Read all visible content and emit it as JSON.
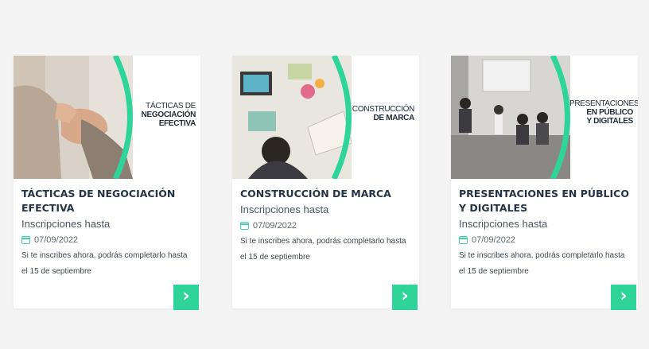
{
  "colors": {
    "accent": "#2fd49a",
    "title": "#233447",
    "background": "#f4f4f5"
  },
  "cards": [
    {
      "thumb_line1": "TÁCTICAS DE",
      "thumb_line2": "NEGOCIACIÓN",
      "thumb_line3": "EFECTIVA",
      "title": "TÁCTICAS DE NEGOCIACIÓN EFECTIVA",
      "inscripciones": "Inscripciones hasta",
      "date": "07/09/2022",
      "desc": "Si te inscribes ahora, podrás completarlo hasta el 15 de septiembre",
      "arrow_icon": "chevron-right-icon"
    },
    {
      "thumb_line1": "CONSTRUCCIÓN",
      "thumb_line2": "DE MARCA",
      "thumb_line3": "",
      "title": "CONSTRUCCIÓN DE MARCA",
      "inscripciones": "Inscripciones hasta",
      "date": "07/09/2022",
      "desc": "Si te inscribes ahora, podrás completarlo hasta el 15 de septiembre",
      "arrow_icon": "chevron-right-icon"
    },
    {
      "thumb_line1": "PRESENTACIONES",
      "thumb_line2": "EN PÚBLICO",
      "thumb_line3": "Y DIGITALES",
      "title": "PRESENTACIONES EN PÚBLICO Y DIGITALES",
      "inscripciones": "Inscripciones hasta",
      "date": "07/09/2022",
      "desc": "Si te inscribes ahora, podrás completarlo hasta el 15 de septiembre",
      "arrow_icon": "chevron-right-icon"
    }
  ]
}
